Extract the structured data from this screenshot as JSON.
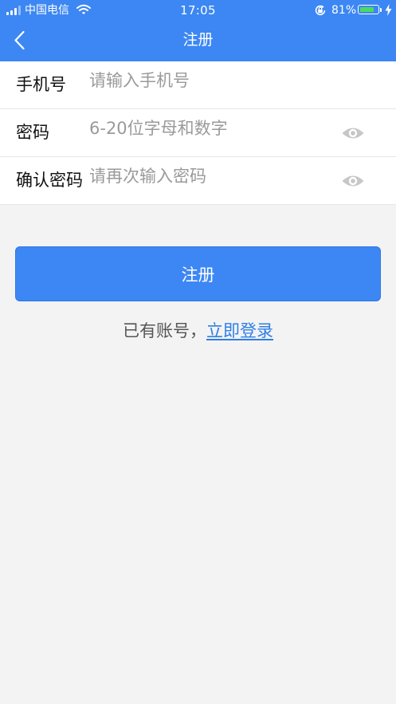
{
  "status_bar": {
    "carrier": "中国电信",
    "time": "17:05",
    "battery_percent": "81%",
    "battery_level": 0.81,
    "icons": [
      "signal-icon",
      "wifi-icon",
      "orientation-lock-icon",
      "battery-icon",
      "charging-bolt-icon"
    ]
  },
  "nav": {
    "title": "注册",
    "back_icon": "chevron-left-icon"
  },
  "form": {
    "phone": {
      "label": "手机号",
      "value": "",
      "placeholder": "请输入手机号"
    },
    "password": {
      "label": "密码",
      "value": "",
      "placeholder": "6-20位字母和数字",
      "toggle_icon": "eye-icon"
    },
    "confirm": {
      "label": "确认密码",
      "value": "",
      "placeholder": "请再次输入密码",
      "toggle_icon": "eye-icon"
    }
  },
  "submit_label": "注册",
  "login_prompt": {
    "text": "已有账号，",
    "link": "立即登录"
  },
  "colors": {
    "primary": "#3c87f3",
    "link": "#2f7ee6",
    "background": "#f3f3f3",
    "placeholder": "#9a9a9a",
    "battery": "#4cd964"
  }
}
